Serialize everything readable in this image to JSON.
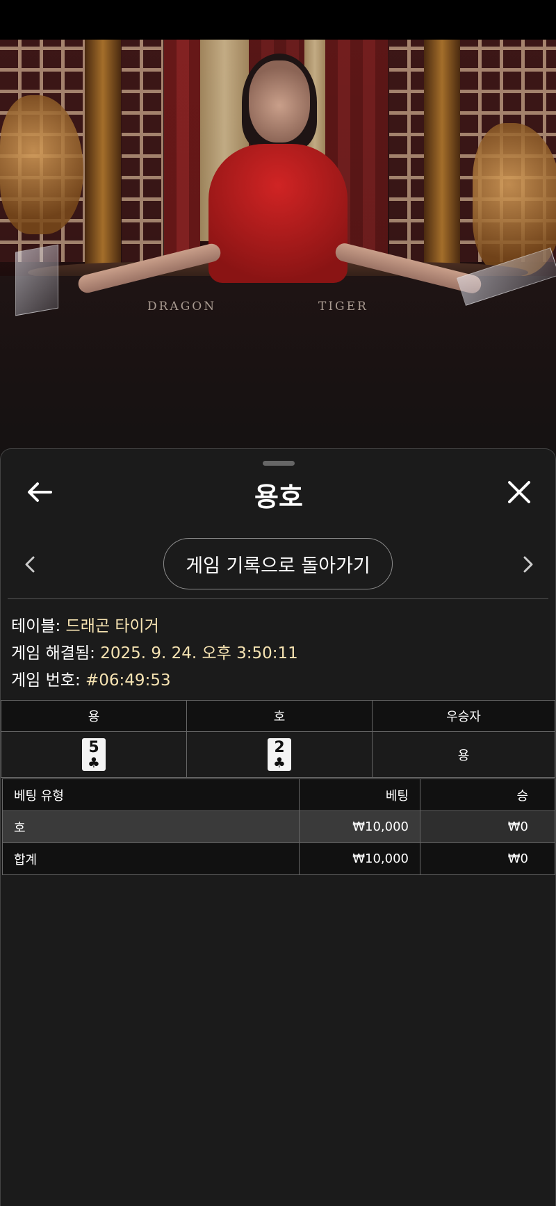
{
  "header": {
    "title": "용호"
  },
  "navigation": {
    "back_to_history_label": "게임 기록으로 돌아가기"
  },
  "video": {
    "table_left_label": "DRAGON",
    "table_right_label": "TIGER"
  },
  "info": {
    "table_label": "테이블:",
    "table_value": "드래곤 타이거",
    "resolved_label": "게임 해결됨:",
    "resolved_value": "2025. 9. 24. 오후 3:50:11",
    "game_no_label": "게임 번호:",
    "game_no_value": "#06:49:53"
  },
  "result": {
    "headers": [
      "용",
      "호",
      "우승자"
    ],
    "dragon_card": {
      "rank": "5",
      "suit": "♣"
    },
    "tiger_card": {
      "rank": "2",
      "suit": "♣"
    },
    "winner": "용"
  },
  "bets": {
    "headers": [
      "베팅 유형",
      "베팅",
      "승"
    ],
    "rows": [
      {
        "type": "호",
        "bet": "₩10,000",
        "win": "₩0"
      },
      {
        "type": "합계",
        "bet": "₩10,000",
        "win": "₩0"
      }
    ]
  },
  "colors": {
    "background": "#1b1b1b",
    "accent_value": "#f6e3b2",
    "highlight_row": "#3a3a3a"
  },
  "icons": [
    "back-arrow-icon",
    "close-icon",
    "chevron-left-icon",
    "chevron-right-icon",
    "club-suit-icon"
  ]
}
